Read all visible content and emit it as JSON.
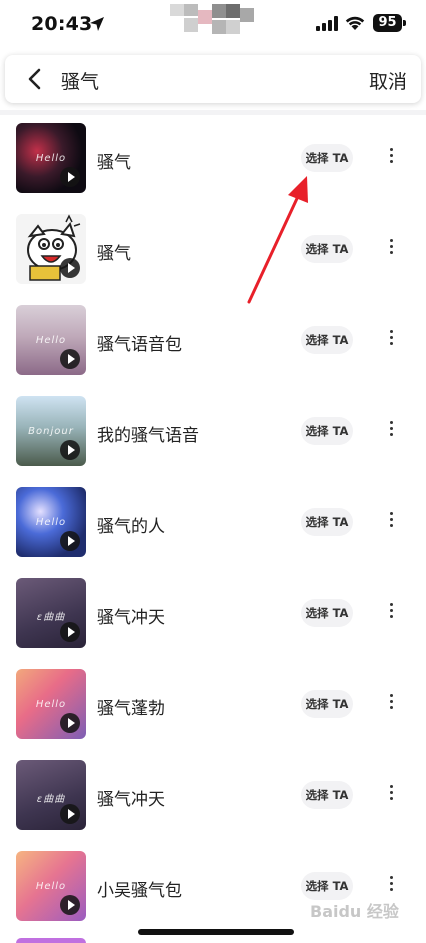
{
  "status_bar": {
    "time": "20:43",
    "battery": "95",
    "icons": [
      "location-arrow-icon",
      "signal-icon",
      "wifi-icon",
      "battery-icon"
    ]
  },
  "search": {
    "query": "骚气",
    "cancel_label": "取消"
  },
  "list": {
    "select_label": "选择 TA",
    "items": [
      {
        "title": "骚气",
        "thumb_text": "Hello"
      },
      {
        "title": "骚气",
        "thumb_text": ""
      },
      {
        "title": "骚气语音包",
        "thumb_text": "Hello"
      },
      {
        "title": "我的骚气语音",
        "thumb_text": "Bonjour"
      },
      {
        "title": "骚气的人",
        "thumb_text": "Hello"
      },
      {
        "title": "骚气冲天",
        "thumb_text": "ε曲曲"
      },
      {
        "title": "骚气蓬勃",
        "thumb_text": "Hello"
      },
      {
        "title": "骚气冲天",
        "thumb_text": "ε曲曲"
      },
      {
        "title": "小吴骚气包",
        "thumb_text": "Hello"
      }
    ]
  },
  "watermark": "Baidu 经验",
  "colors": {
    "annotation_arrow": "#e8202a",
    "button_bg": "#f2f2f4"
  }
}
